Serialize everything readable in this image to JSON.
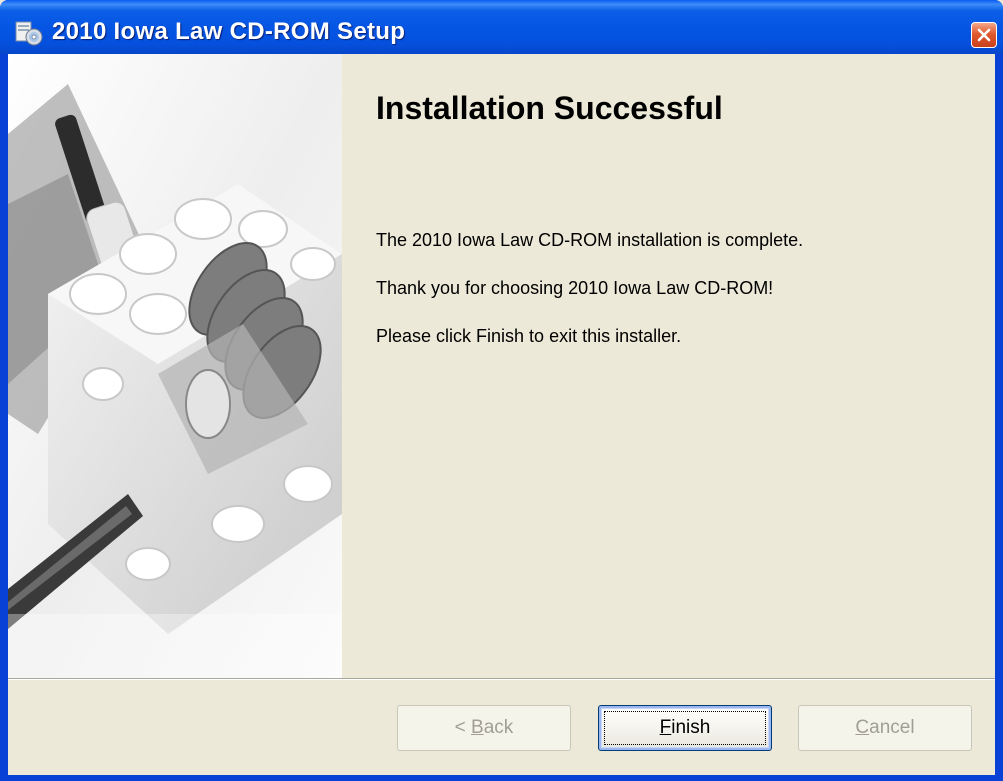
{
  "window": {
    "title": "2010 Iowa Law CD-ROM Setup"
  },
  "page": {
    "heading": "Installation Successful",
    "lines": [
      "The 2010 Iowa Law CD-ROM installation is complete.",
      "Thank you for choosing 2010 Iowa Law CD-ROM!",
      "Please click Finish to exit this installer."
    ]
  },
  "buttons": {
    "back": {
      "prefix": "< ",
      "mnemonic": "B",
      "rest": "ack",
      "enabled": false
    },
    "finish": {
      "prefix": "",
      "mnemonic": "F",
      "rest": "inish",
      "enabled": true,
      "default": true
    },
    "cancel": {
      "prefix": "",
      "mnemonic": "C",
      "rest": "ancel",
      "enabled": false
    }
  },
  "icons": {
    "title_icon": "setup-cd-icon",
    "close": "close-icon",
    "side": "lego-gear-image"
  },
  "colors": {
    "titlebar": "#0554e3",
    "dialog_bg": "#ece9d8",
    "close_button": "#e2592f",
    "disabled_text": "#a19f93"
  }
}
